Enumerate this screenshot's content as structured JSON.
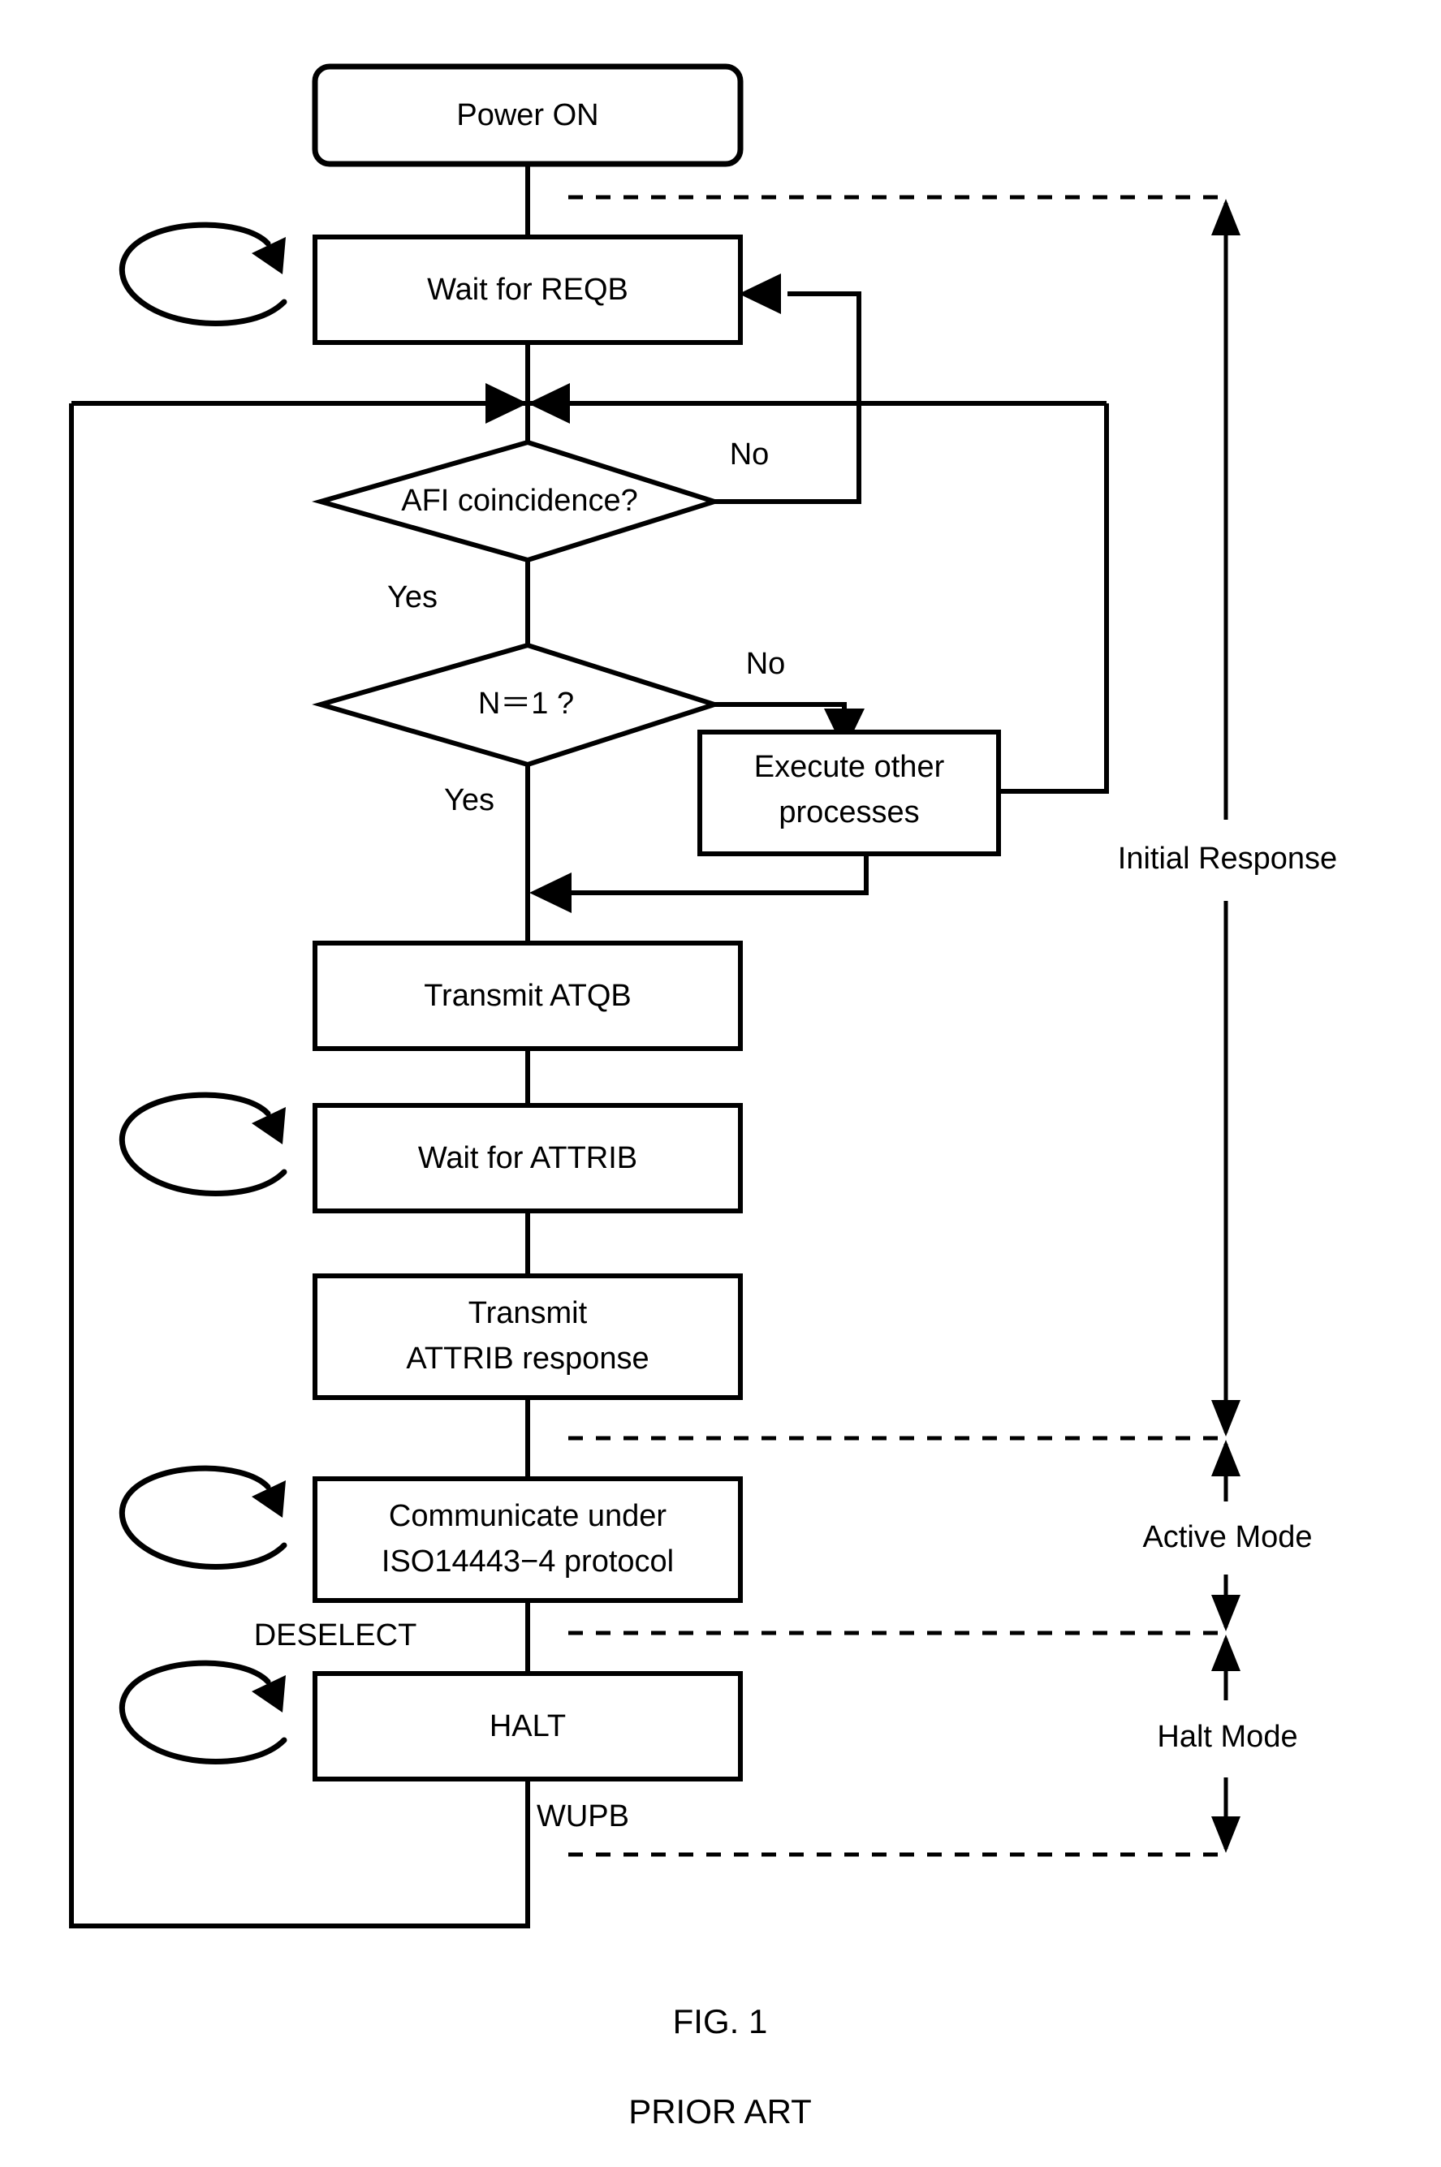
{
  "figure": {
    "caption": "FIG. 1",
    "subcaption": "PRIOR ART"
  },
  "nodes": {
    "power_on": "Power ON",
    "wait_reqb": "Wait for REQB",
    "afi_decision": "AFI coincidence?",
    "n_decision": "N＝1 ?",
    "execute_other_line1": "Execute other",
    "execute_other_line2": "processes",
    "transmit_atqb": "Transmit ATQB",
    "wait_attrib": "Wait for ATTRIB",
    "transmit_attrib_resp_line1": "Transmit",
    "transmit_attrib_resp_line2": "ATTRIB response",
    "communicate_line1": "Communicate under",
    "communicate_line2": "ISO14443−4 protocol",
    "halt": "HALT"
  },
  "branch_labels": {
    "afi_no": "No",
    "afi_yes": "Yes",
    "n_no": "No",
    "n_yes": "Yes"
  },
  "event_labels": {
    "deselect": "DESELECT",
    "wupb": "WUPB"
  },
  "mode_labels": {
    "initial_response": "Initial Response",
    "active_mode": "Active Mode",
    "halt_mode": "Halt Mode"
  },
  "colors": {
    "stroke": "#000000",
    "fill": "#ffffff",
    "background": "#ffffff"
  },
  "icons": {
    "self_loop": "self-loop-arrow-icon",
    "flow_arrow": "flow-arrowhead-icon",
    "span_marker": "span-double-arrow-icon"
  }
}
